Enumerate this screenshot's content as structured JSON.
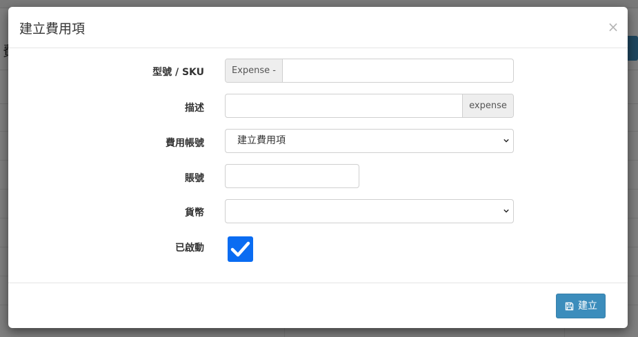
{
  "modal": {
    "title": "建立費用項",
    "close_glyph": "×",
    "fields": {
      "sku": {
        "label": "型號 / SKU",
        "prefix": "Expense -",
        "value": ""
      },
      "description": {
        "label": "描述",
        "suffix": "expense",
        "value": ""
      },
      "expense_account": {
        "label": "費用帳號",
        "selected": "建立費用項"
      },
      "account_number": {
        "label": "賬號",
        "value": ""
      },
      "currency": {
        "label": "貨幣",
        "selected": ""
      },
      "active": {
        "label": "已啟動",
        "checked": true
      }
    },
    "footer": {
      "submit_label": "建立",
      "submit_icon": "save-icon"
    }
  },
  "background": {
    "header_char": "費"
  },
  "colors": {
    "primary": "#3c8dbc",
    "checkbox": "#0a6cf2",
    "backdrop": "rgba(0,0,0,0.5)"
  }
}
